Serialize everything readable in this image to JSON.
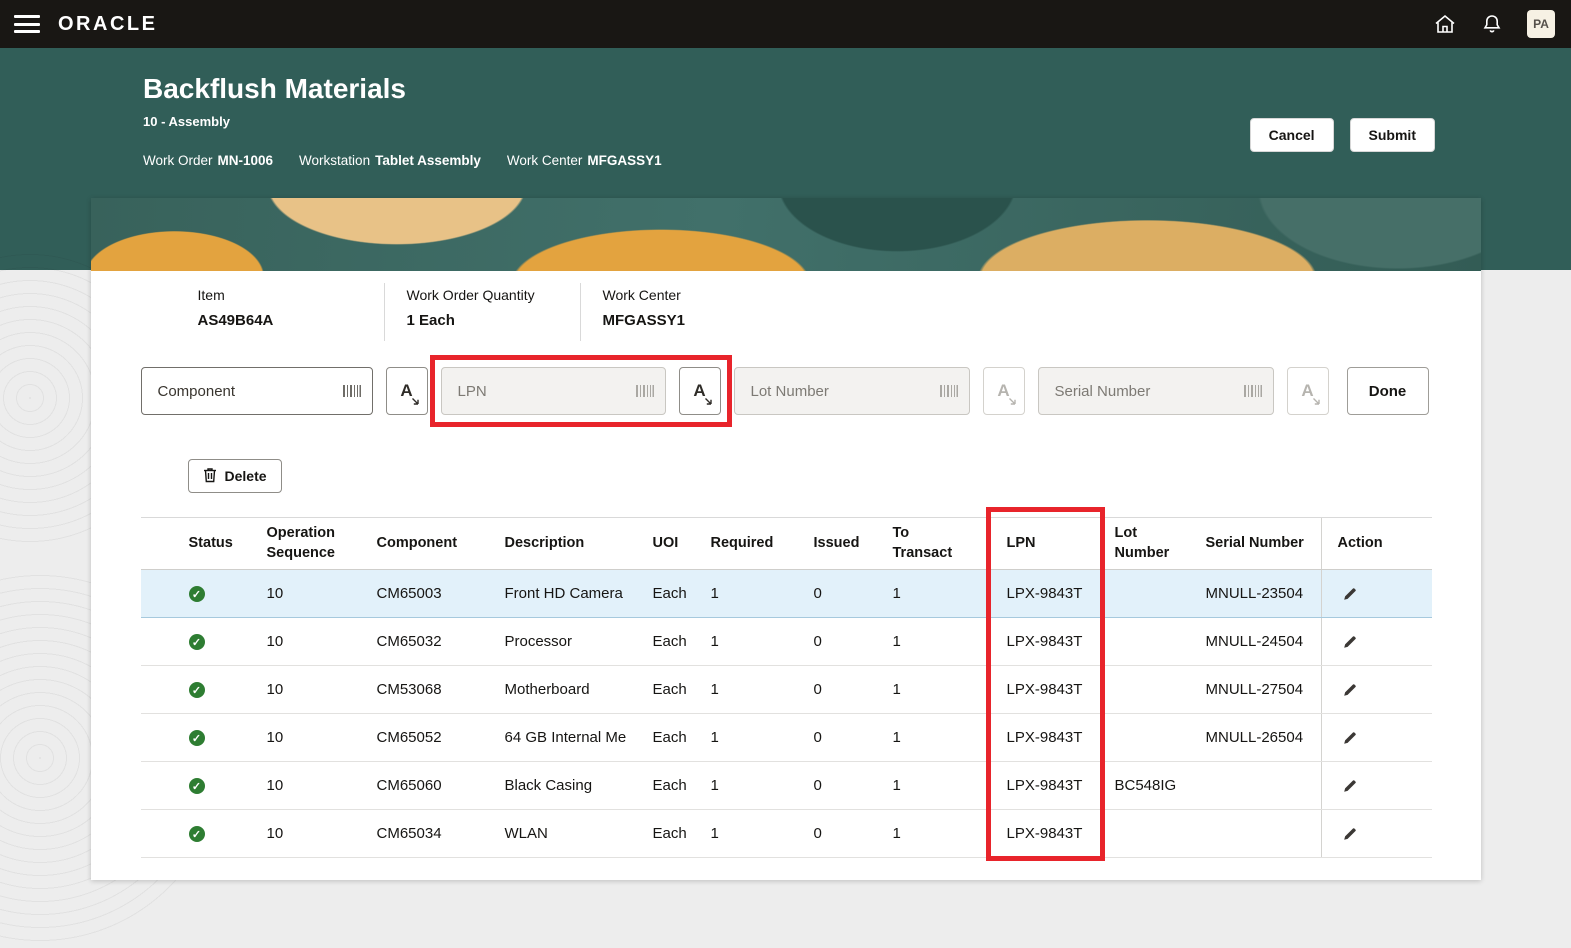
{
  "colors": {
    "annotation_red": "#e8242b",
    "header_teal": "#315e58",
    "success_green": "#2e7d32",
    "selected_row": "#e2f1fa"
  },
  "topbar": {
    "brand": "ORACLE",
    "avatar": "PA"
  },
  "header": {
    "title": "Backflush Materials",
    "subtitle": "10 - Assembly",
    "meta": [
      {
        "label": "Work Order",
        "value": "MN-1006"
      },
      {
        "label": "Workstation",
        "value": "Tablet Assembly"
      },
      {
        "label": "Work Center",
        "value": "MFGASSY1"
      }
    ],
    "cancel_label": "Cancel",
    "submit_label": "Submit"
  },
  "summary": {
    "fields": [
      {
        "label": "Item",
        "value": "AS49B64A"
      },
      {
        "label": "Work Order Quantity",
        "value": "1 Each"
      },
      {
        "label": "Work Center",
        "value": "MFGASSY1"
      }
    ]
  },
  "scan": {
    "fields": [
      {
        "name": "component",
        "placeholder": "Component"
      },
      {
        "name": "lpn",
        "placeholder": "LPN"
      },
      {
        "name": "lot_number",
        "placeholder": "Lot Number"
      },
      {
        "name": "serial_number",
        "placeholder": "Serial Number"
      }
    ],
    "done_label": "Done"
  },
  "toolbar": {
    "delete_label": "Delete"
  },
  "table": {
    "columns": [
      {
        "key": "status",
        "label": "Status"
      },
      {
        "key": "op_seq",
        "label": "Operation\nSequence"
      },
      {
        "key": "component",
        "label": "Component"
      },
      {
        "key": "description",
        "label": "Description"
      },
      {
        "key": "uoi",
        "label": "UOI"
      },
      {
        "key": "required",
        "label": "Required"
      },
      {
        "key": "issued",
        "label": "Issued"
      },
      {
        "key": "to_transact",
        "label": "To\nTransact"
      },
      {
        "key": "lpn",
        "label": "LPN"
      },
      {
        "key": "lot",
        "label": "Lot\nNumber"
      },
      {
        "key": "serial",
        "label": "Serial Number"
      },
      {
        "key": "action",
        "label": "Action"
      }
    ],
    "rows": [
      {
        "selected": true,
        "status": "ok",
        "op_seq": "10",
        "component": "CM65003",
        "description": "Front HD Camera",
        "uoi": "Each",
        "required": "1",
        "issued": "0",
        "to_transact": "1",
        "lpn": "LPX-9843T",
        "lot": "",
        "serial": "MNULL-23504"
      },
      {
        "selected": false,
        "status": "ok",
        "op_seq": "10",
        "component": "CM65032",
        "description": "Processor",
        "uoi": "Each",
        "required": "1",
        "issued": "0",
        "to_transact": "1",
        "lpn": "LPX-9843T",
        "lot": "",
        "serial": "MNULL-24504"
      },
      {
        "selected": false,
        "status": "ok",
        "op_seq": "10",
        "component": "CM53068",
        "description": "Motherboard",
        "uoi": "Each",
        "required": "1",
        "issued": "0",
        "to_transact": "1",
        "lpn": "LPX-9843T",
        "lot": "",
        "serial": "MNULL-27504"
      },
      {
        "selected": false,
        "status": "ok",
        "op_seq": "10",
        "component": "CM65052",
        "description": "64 GB Internal Me",
        "uoi": "Each",
        "required": "1",
        "issued": "0",
        "to_transact": "1",
        "lpn": "LPX-9843T",
        "lot": "",
        "serial": "MNULL-26504"
      },
      {
        "selected": false,
        "status": "ok",
        "op_seq": "10",
        "component": "CM65060",
        "description": "Black Casing",
        "uoi": "Each",
        "required": "1",
        "issued": "0",
        "to_transact": "1",
        "lpn": "LPX-9843T",
        "lot": "BC548IG",
        "serial": ""
      },
      {
        "selected": false,
        "status": "ok",
        "op_seq": "10",
        "component": "CM65034",
        "description": "WLAN",
        "uoi": "Each",
        "required": "1",
        "issued": "0",
        "to_transact": "1",
        "lpn": "LPX-9843T",
        "lot": "",
        "serial": ""
      }
    ]
  }
}
